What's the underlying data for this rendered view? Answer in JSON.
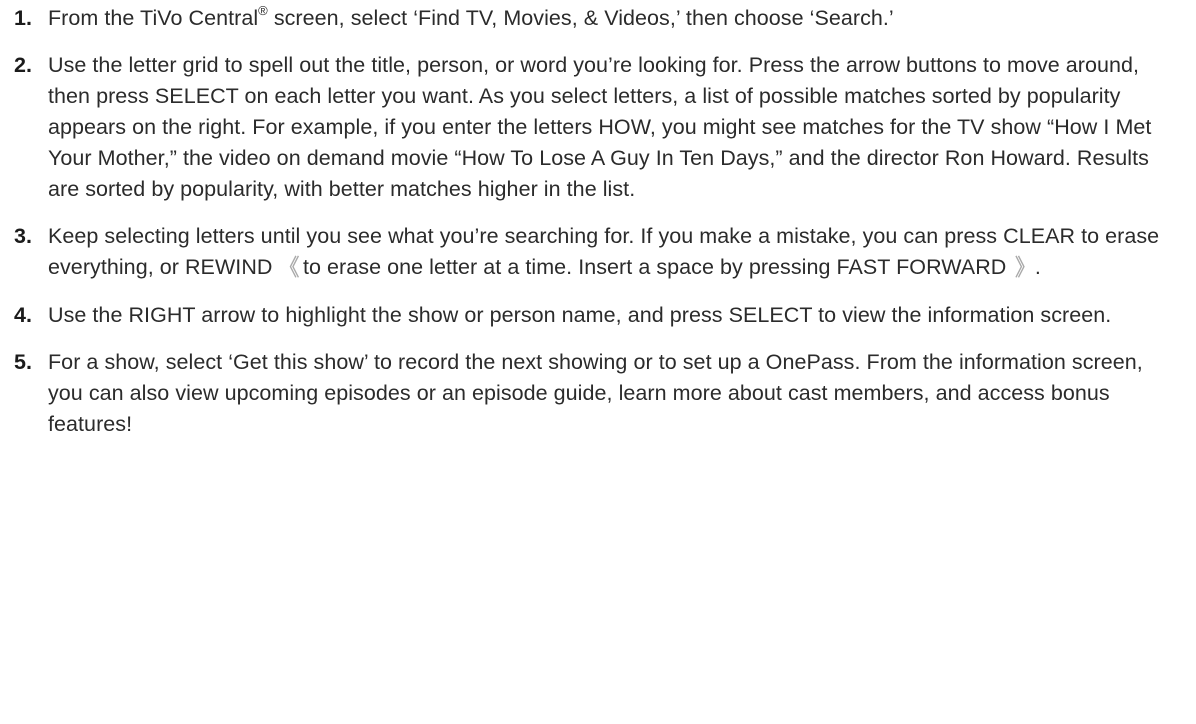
{
  "steps": [
    {
      "number": "1.",
      "text_a": "From the TiVo Central",
      "mark": "®",
      "text_b": " screen, select ‘Find TV, Movies, & Videos,’ then choose ‘Search.’"
    },
    {
      "number": "2.",
      "text": "Use the letter grid to spell out the title, person, or word you’re looking for. Press the arrow buttons to move around, then press SELECT on each letter you want. As you select letters, a list of possible matches sorted by popularity appears on the right. For example, if you enter the letters HOW, you might see matches for the TV show “How I Met Your Mother,” the video on demand movie “How To Lose A Guy In Ten Days,” and the director Ron Howard. Results are sorted by popularity, with better matches higher in the list."
    },
    {
      "number": "3.",
      "text_a": "Keep selecting letters until you see what you’re searching for. If you make a mistake, you can press CLEAR to erase everything, or REWIND",
      "text_b": "to erase one letter at a time. Insert a space by pressing FAST FORWARD",
      "text_c": "."
    },
    {
      "number": "4.",
      "text": "Use the RIGHT arrow to highlight the show or person name, and press SELECT to view the information screen."
    },
    {
      "number": "5.",
      "text": "For a show, select ‘Get this show’ to record the next showing or to set up a OnePass. From the information screen, you can also view upcoming episodes or an episode guide, learn more about cast members, and access bonus features!"
    }
  ],
  "icons": {
    "rewind": "rewind-icon",
    "fast_forward": "fast-forward-icon"
  }
}
